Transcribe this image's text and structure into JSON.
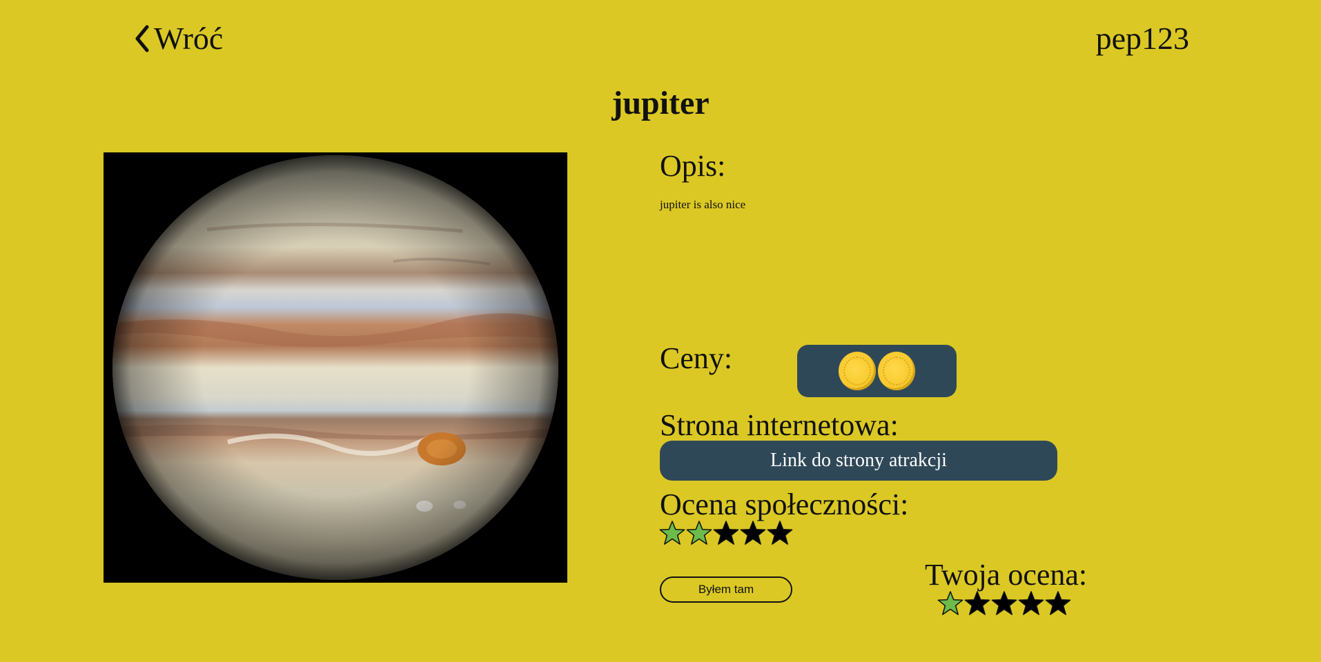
{
  "header": {
    "back_label": "Wróć",
    "username": "pep123"
  },
  "attraction": {
    "name": "jupiter",
    "description_heading": "Opis:",
    "description": "jupiter is also nice",
    "price_heading": "Ceny:",
    "price_level": 2,
    "website_heading": "Strona internetowa:",
    "website_button": "Link do strony atrakcji",
    "community_heading": "Ocena społeczności:",
    "community_rating": 2,
    "rating_max": 5,
    "visited_button": "Byłem tam",
    "your_rating_heading": "Twoja ocena:",
    "your_rating": 1
  },
  "colors": {
    "background": "#dbc824",
    "button_dark": "#2f4858",
    "star_filled": "#6dbb4a",
    "star_empty": "#000000",
    "coin": "#f8c92e"
  },
  "icons": {
    "back": "chevron-left-icon",
    "star": "star-icon",
    "coin": "coin-icon"
  }
}
